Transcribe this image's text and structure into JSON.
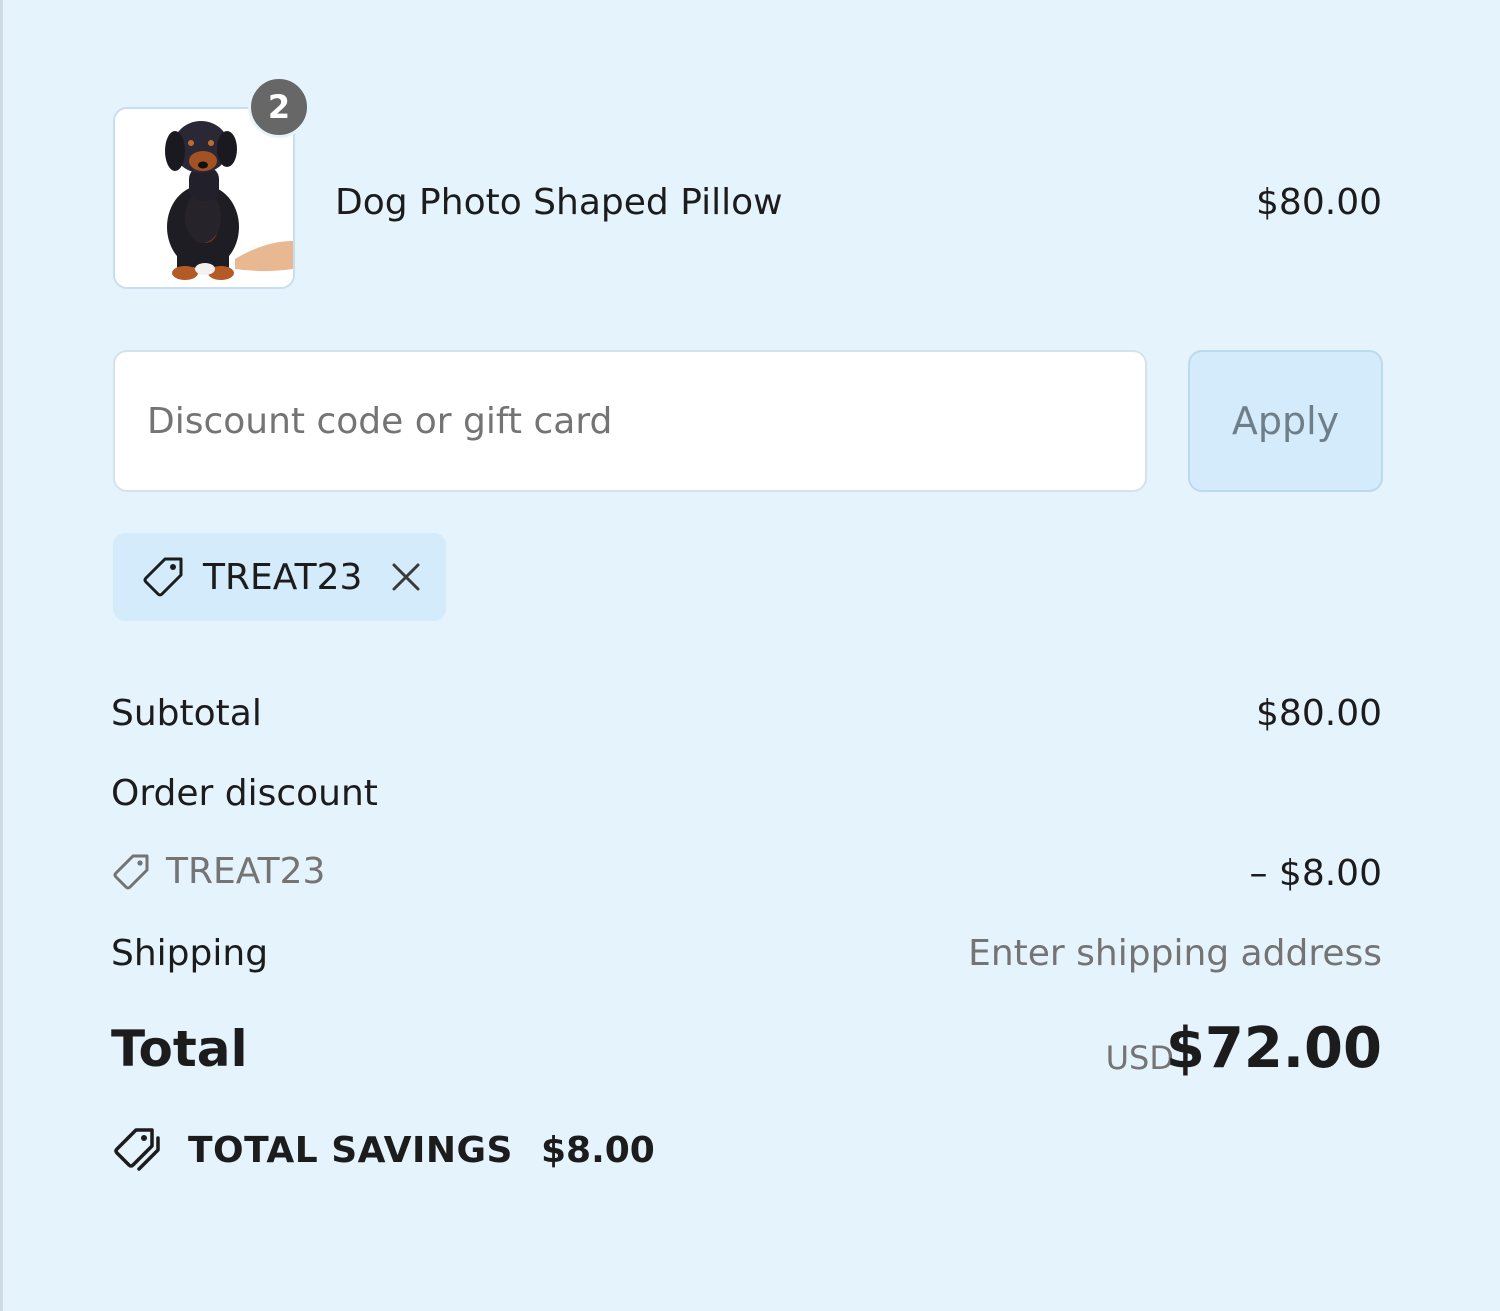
{
  "line_item": {
    "quantity": "2",
    "name": "Dog Photo Shaped Pillow",
    "price": "$80.00",
    "thumbnail_icon": "dog-photo-pillow-image"
  },
  "discount": {
    "placeholder": "Discount code or gift card",
    "value": "",
    "apply_label": "Apply",
    "applied_code": "TREAT23"
  },
  "summary": {
    "subtotal_label": "Subtotal",
    "subtotal_value": "$80.00",
    "order_discount_label": "Order discount",
    "order_discount_code": "TREAT23",
    "order_discount_value": "– $8.00",
    "shipping_label": "Shipping",
    "shipping_value": "Enter shipping address",
    "total_label": "Total",
    "total_currency": "USD",
    "total_value": "$72.00",
    "savings_label": "TOTAL SAVINGS",
    "savings_value": "$8.00"
  },
  "colors": {
    "background": "#e5f3fd",
    "accent_chip": "#d4ebfb",
    "muted_text": "#747474",
    "badge": "#676767"
  }
}
